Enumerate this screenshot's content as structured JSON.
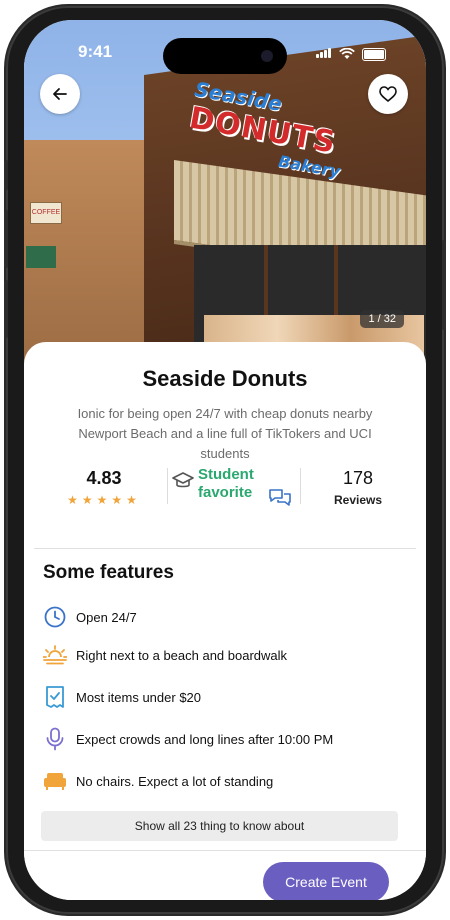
{
  "status_bar": {
    "time": "9:41"
  },
  "hero": {
    "sign_script": "Seaside",
    "sign_main": "DONUTS",
    "sign_sub": "Bakery",
    "coffee_sign": "COFFEE",
    "photo_counter": "1 / 32"
  },
  "place": {
    "name": "Seaside Donuts",
    "description": "Ionic for being open 24/7 with cheap donuts nearby Newport Beach and a line full of TikTokers and UCI students"
  },
  "stats": {
    "rating": "4.83",
    "stars": 5,
    "badge_line1": "Student",
    "badge_line2": "favorite",
    "reviews_count": "178",
    "reviews_label": "Reviews"
  },
  "features": {
    "title": "Some features",
    "items": [
      {
        "icon": "clock-icon",
        "label": "Open 24/7"
      },
      {
        "icon": "sunrise-icon",
        "label": "Right next to a beach and boardwalk"
      },
      {
        "icon": "receipt-icon",
        "label": "Most items under $20"
      },
      {
        "icon": "microphone-icon",
        "label": "Expect crowds and long lines after 10:00 PM"
      },
      {
        "icon": "sofa-icon",
        "label": "No chairs. Expect a lot of standing"
      }
    ],
    "show_all_label": "Show all 23 thing to know about"
  },
  "actions": {
    "create_event_label": "Create Event"
  },
  "colors": {
    "accent_purple": "#6a5fc1",
    "badge_green": "#2aa86f",
    "star_orange": "#f0a43a",
    "icon_blue": "#3a73c8",
    "icon_orange": "#f0a43a"
  }
}
